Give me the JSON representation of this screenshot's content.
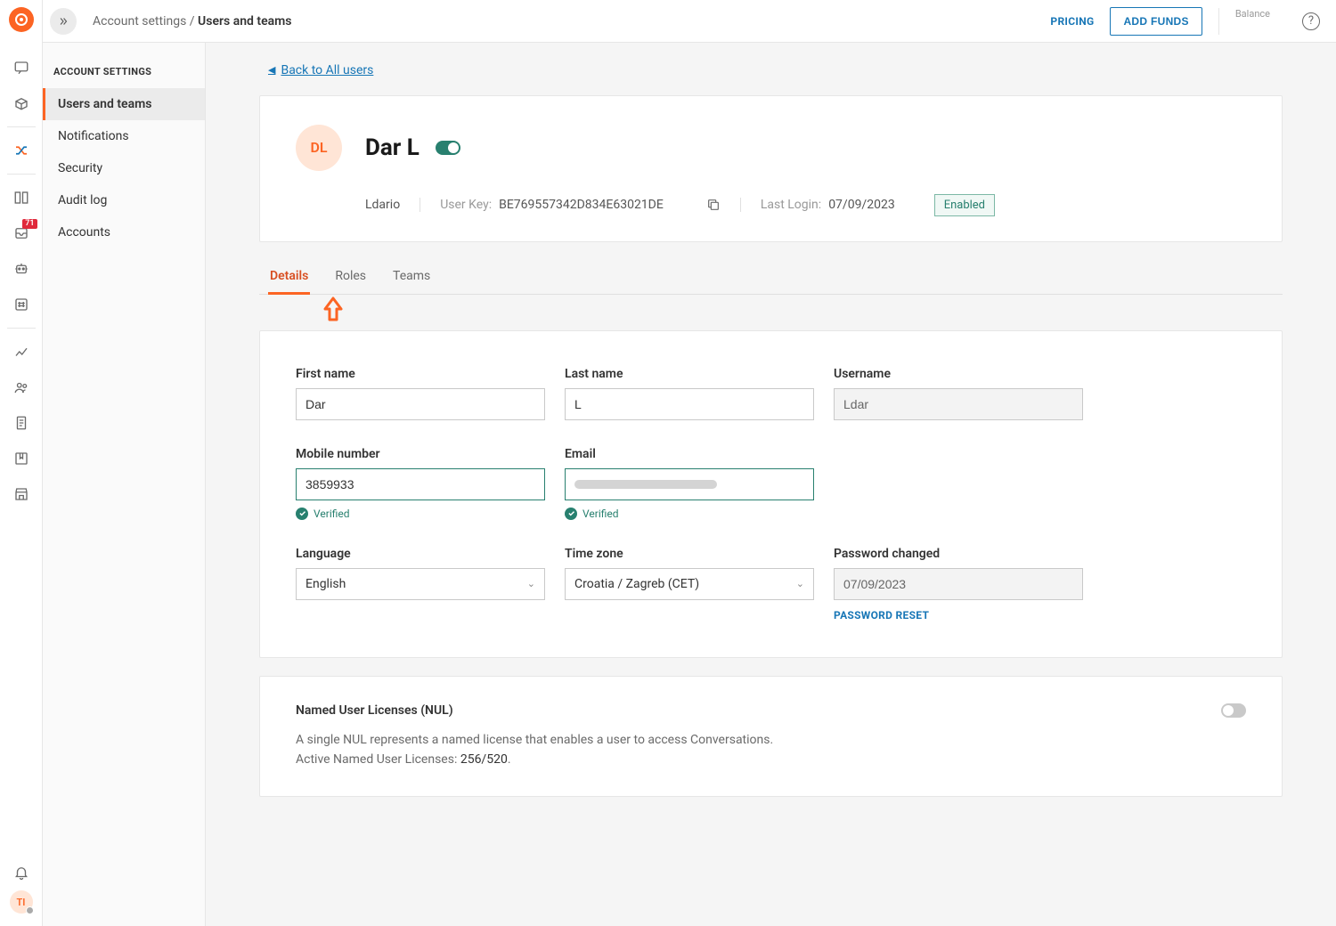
{
  "header": {
    "breadcrumb_parent": "Account settings",
    "breadcrumb_current": "Users and teams",
    "pricing": "PRICING",
    "add_funds": "ADD FUNDS",
    "balance_label": "Balance"
  },
  "rail": {
    "badge": "71",
    "avatar": "TI"
  },
  "sidebar": {
    "title": "ACCOUNT SETTINGS",
    "items": [
      {
        "label": "Users and teams",
        "active": true
      },
      {
        "label": "Notifications",
        "active": false
      },
      {
        "label": "Security",
        "active": false
      },
      {
        "label": "Audit log",
        "active": false
      },
      {
        "label": "Accounts",
        "active": false
      }
    ]
  },
  "page": {
    "back_link": "Back to All users",
    "user": {
      "avatar_initials": "DL",
      "display_name": "Dar   L",
      "enabled": true,
      "username": "Ldario",
      "user_key_label": "User Key:",
      "user_key": "BE769557342D834E63021DE",
      "last_login_label": "Last Login:",
      "last_login": "07/09/2023",
      "status": "Enabled"
    },
    "tabs": [
      {
        "label": "Details",
        "active": true
      },
      {
        "label": "Roles",
        "active": false
      },
      {
        "label": "Teams",
        "active": false
      }
    ],
    "form": {
      "first_name_label": "First name",
      "first_name": "Dar",
      "last_name_label": "Last name",
      "last_name": "L",
      "username_label": "Username",
      "username": "Ldar",
      "mobile_label": "Mobile number",
      "mobile": "3859933",
      "mobile_verified": "Verified",
      "email_label": "Email",
      "email_verified": "Verified",
      "language_label": "Language",
      "language": "English",
      "timezone_label": "Time zone",
      "timezone": "Croatia / Zagreb (CET)",
      "password_changed_label": "Password changed",
      "password_changed": "07/09/2023",
      "password_reset": "PASSWORD RESET"
    },
    "nul": {
      "title": "Named User Licenses (NUL)",
      "desc1": "A single NUL represents a named license that enables a user to access Conversations.",
      "desc2_prefix": "Active Named User Licenses: ",
      "desc2_value": "256/520",
      "toggle_on": false
    }
  }
}
